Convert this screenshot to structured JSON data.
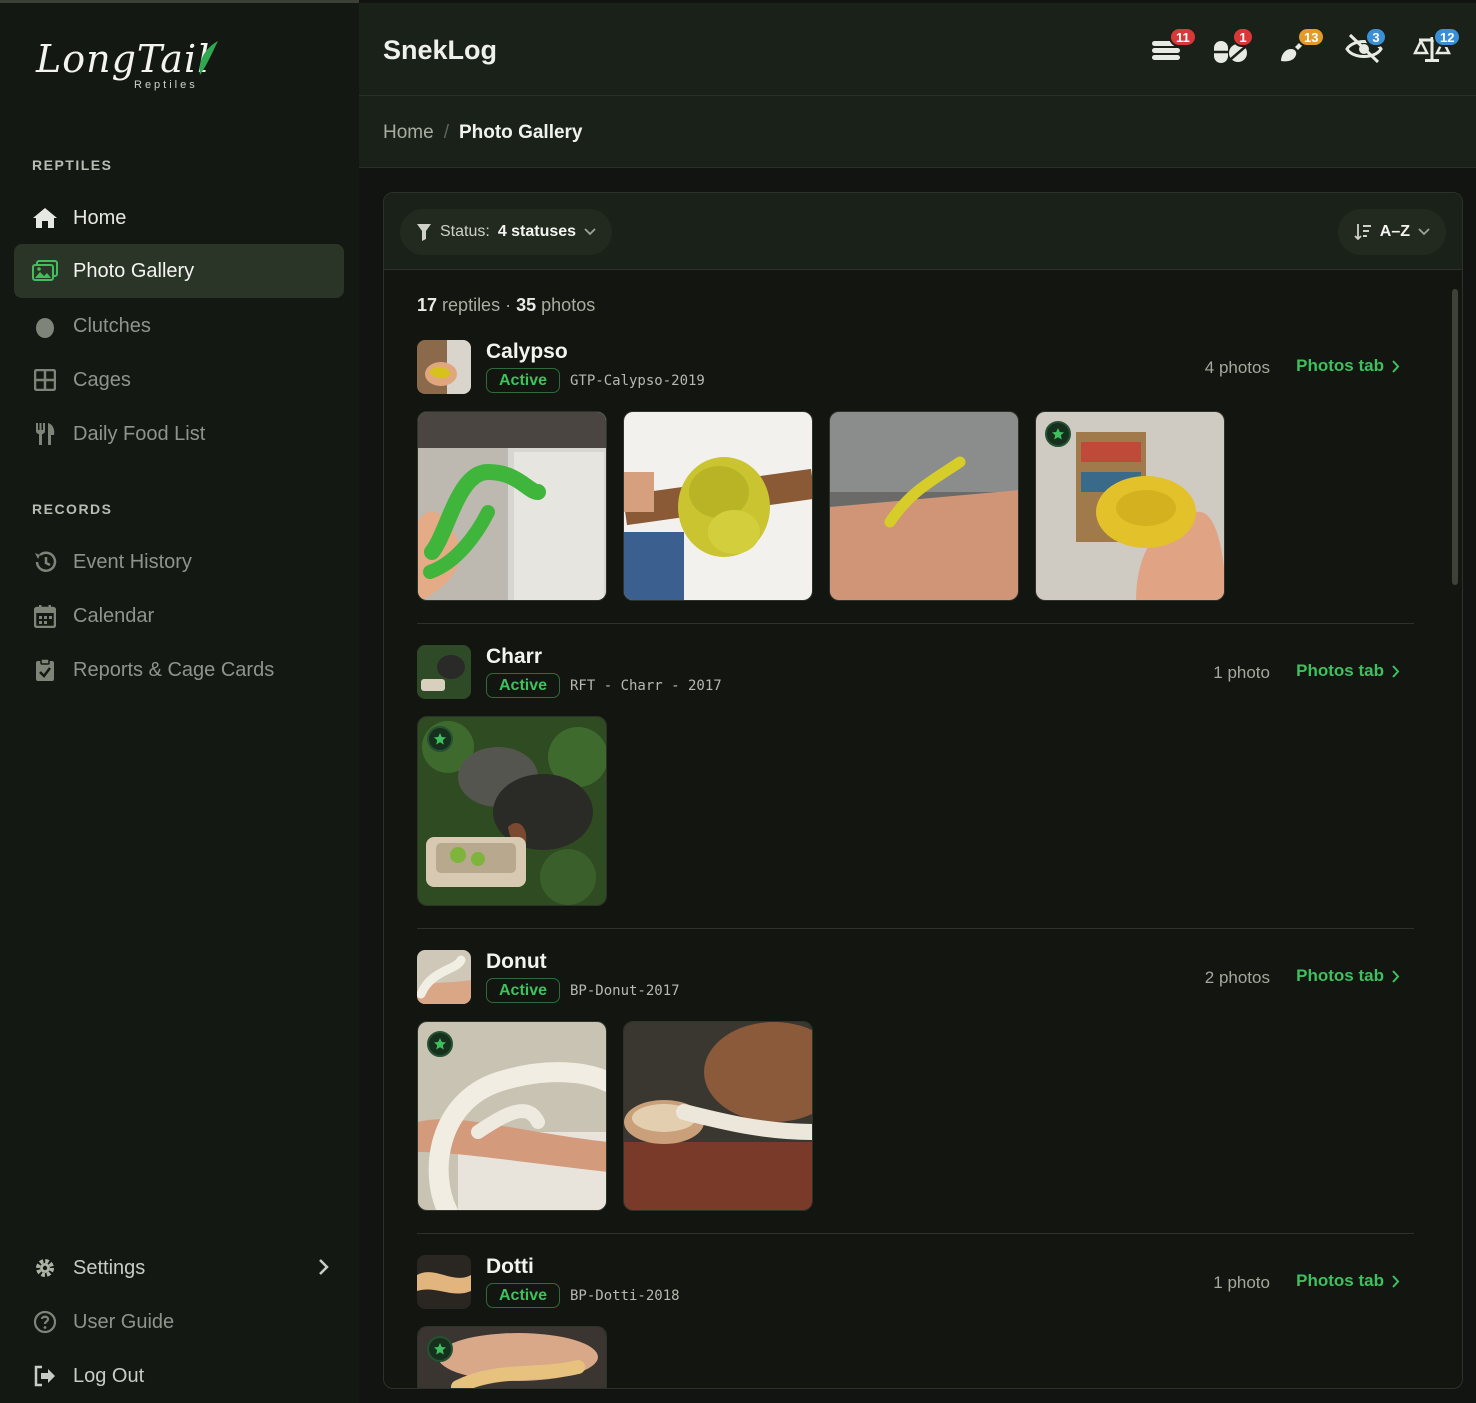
{
  "brand": {
    "name": "LongTail",
    "sub": "Reptiles"
  },
  "app_title": "SnekLog",
  "header_icons": [
    {
      "icon": "food-stack-icon",
      "badge": "11",
      "badge_color": "#d93838"
    },
    {
      "icon": "pills-icon",
      "badge": "1",
      "badge_color": "#d93838"
    },
    {
      "icon": "brush-icon",
      "badge": "13",
      "badge_color": "#e39a2c"
    },
    {
      "icon": "eye-slash-icon",
      "badge": "3",
      "badge_color": "#3b8fd6"
    },
    {
      "icon": "scale-icon",
      "badge": "12",
      "badge_color": "#3b8fd6"
    }
  ],
  "sidebar": {
    "section_reptiles": "REPTILES",
    "section_records": "RECORDS",
    "items": [
      {
        "label": "Home",
        "icon": "home-icon"
      },
      {
        "label": "Photo Gallery",
        "icon": "images-icon"
      },
      {
        "label": "Clutches",
        "icon": "egg-icon"
      },
      {
        "label": "Cages",
        "icon": "grid-icon"
      },
      {
        "label": "Daily Food List",
        "icon": "utensils-icon"
      },
      {
        "label": "Event History",
        "icon": "history-icon"
      },
      {
        "label": "Calendar",
        "icon": "calendar-icon"
      },
      {
        "label": "Reports & Cage Cards",
        "icon": "clipboard-check-icon"
      }
    ],
    "bottom": [
      {
        "label": "Settings",
        "icon": "gear-icon"
      },
      {
        "label": "User Guide",
        "icon": "question-icon"
      },
      {
        "label": "Log Out",
        "icon": "logout-icon"
      }
    ]
  },
  "breadcrumb": {
    "home": "Home",
    "sep": "/",
    "current": "Photo Gallery"
  },
  "filter": {
    "label": "Status:",
    "value": "4 statuses"
  },
  "sort": {
    "label": "A–Z"
  },
  "summary": {
    "reptiles": "17",
    "reptiles_word": "reptiles",
    "dot": "·",
    "photos": "35",
    "photos_word": "photos"
  },
  "link_label": "Photos tab",
  "groups": [
    {
      "name": "Calypso",
      "status": "Active",
      "code": "GTP-Calypso-2019",
      "count": "4 photos",
      "photos": 4
    },
    {
      "name": "Charr",
      "status": "Active",
      "code": "RFT - Charr - 2017",
      "count": "1 photo",
      "photos": 1
    },
    {
      "name": "Donut",
      "status": "Active",
      "code": "BP-Donut-2017",
      "count": "2 photos",
      "photos": 2
    },
    {
      "name": "Dotti",
      "status": "Active",
      "code": "BP-Dotti-2018",
      "count": "1 photo",
      "photos": 1
    }
  ],
  "colors": {
    "accent": "#3fbf5e",
    "active_nav": "#2a3527",
    "background": "#111410"
  }
}
